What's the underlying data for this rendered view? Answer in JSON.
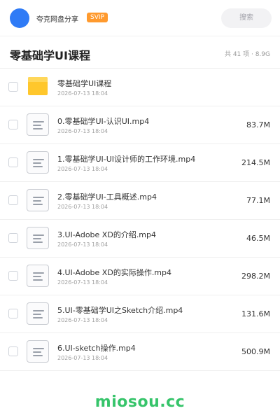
{
  "header": {
    "share_title": "夸克网盘分享",
    "svip_label": "SVIP",
    "search_label": "搜索"
  },
  "folder": {
    "title": "零基础学UI课程",
    "meta": "共 41 项 · 8.9G"
  },
  "files": [
    {
      "type": "folder",
      "name": "零基础学UI课程",
      "date": "2026-07-13 18:04",
      "size": ""
    },
    {
      "type": "video",
      "name": "0.零基础学UI-认识UI.mp4",
      "date": "2026-07-13 18:04",
      "size": "83.7M"
    },
    {
      "type": "video",
      "name": "1.零基础学UI-UI设计师的工作环境.mp4",
      "date": "2026-07-13 18:04",
      "size": "214.5M"
    },
    {
      "type": "video",
      "name": "2.零基础学UI-工具概述.mp4",
      "date": "2026-07-13 18:04",
      "size": "77.1M"
    },
    {
      "type": "video",
      "name": "3.UI-Adobe XD的介绍.mp4",
      "date": "2026-07-13 18:04",
      "size": "46.5M"
    },
    {
      "type": "video",
      "name": "4.UI-Adobe XD的实际操作.mp4",
      "date": "2026-07-13 18:04",
      "size": "298.2M"
    },
    {
      "type": "video",
      "name": "5.UI-零基础学UI之Sketch介绍.mp4",
      "date": "2026-07-13 18:04",
      "size": "131.6M"
    },
    {
      "type": "video",
      "name": "6.UI-sketch操作.mp4",
      "date": "2026-07-13 18:04",
      "size": "500.9M"
    }
  ],
  "watermark": "miosou.cc",
  "colors": {
    "accent": "#2f7bf6",
    "svip": "#ff9a2e",
    "folder": "#ffc72c",
    "watermark": "#36c46a"
  }
}
